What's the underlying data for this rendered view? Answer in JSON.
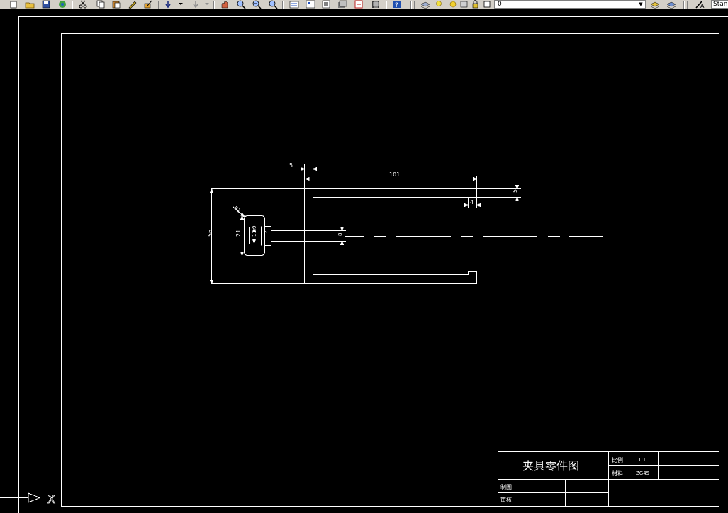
{
  "toolbar": {
    "layer_value": "0",
    "text_style_value": "Standard"
  },
  "drawing": {
    "dimensions": {
      "left_gap": "5",
      "top_length": "101",
      "right_height": "5",
      "slot_width": "4",
      "overall_height": "56",
      "head_height": "21",
      "inner_dia": "11.9",
      "neck_dia": "12",
      "radius": "R1",
      "shaft_dia": "8"
    },
    "title_block": {
      "title": "夹具零件图",
      "scale_label": "比例",
      "scale_value": "1:1",
      "material_label": "材料",
      "material_value": "ZG45",
      "drawn_label": "制图",
      "review_label": "审核"
    },
    "ucs_x_label": "X"
  }
}
